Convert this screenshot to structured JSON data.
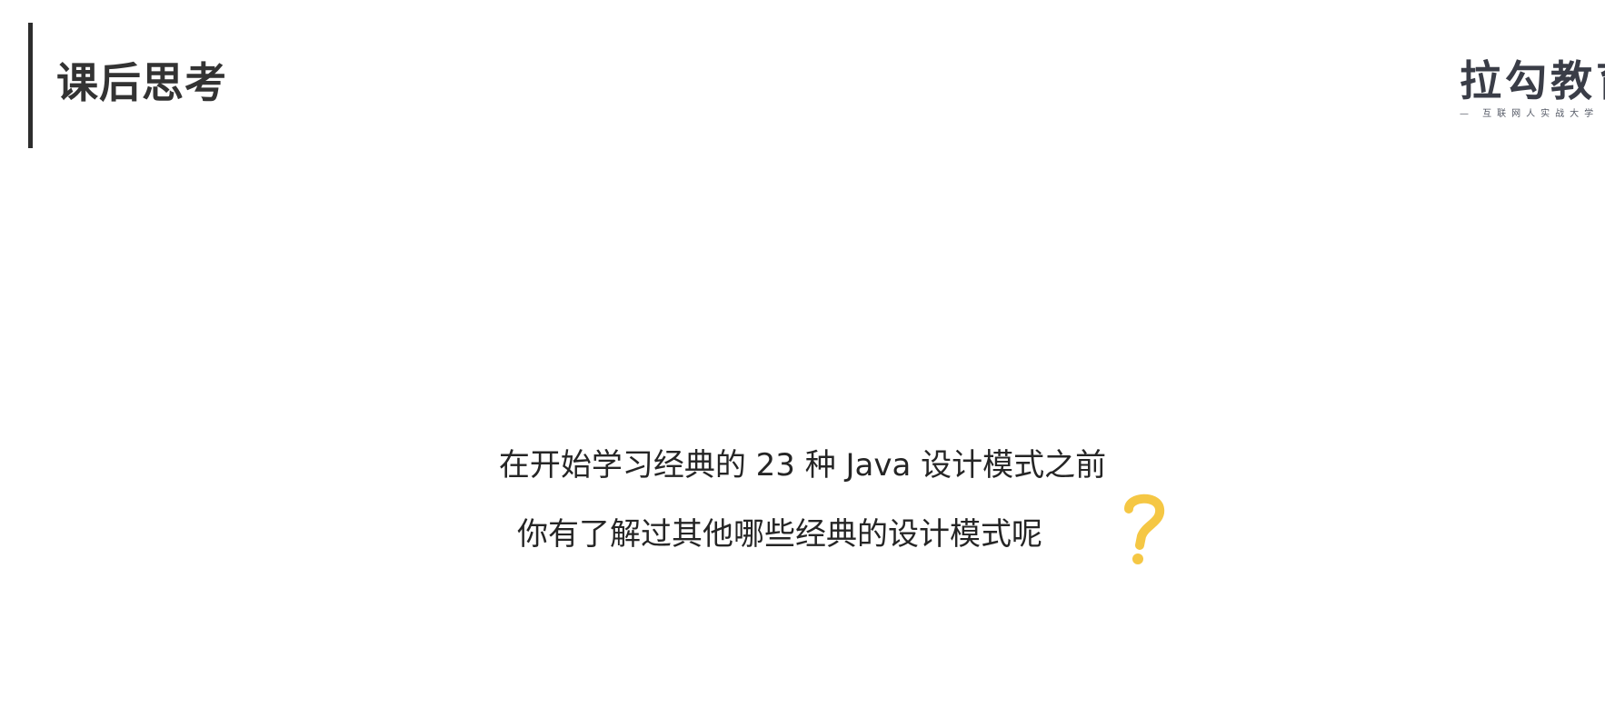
{
  "slide": {
    "title": "课后思考"
  },
  "brand": {
    "name": "拉勾教育",
    "slogan": "— 互联网人实战大学",
    "logo_color": "#3a3d47"
  },
  "question": {
    "line1": "在开始学习经典的 23 种 Java 设计模式之前",
    "line2": "你有了解过其他哪些经典的设计模式呢",
    "icon": "question-mark-icon",
    "icon_color": "#f5c744"
  },
  "colors": {
    "accent_bar": "#2d2d2d",
    "background": "#ffffff"
  }
}
